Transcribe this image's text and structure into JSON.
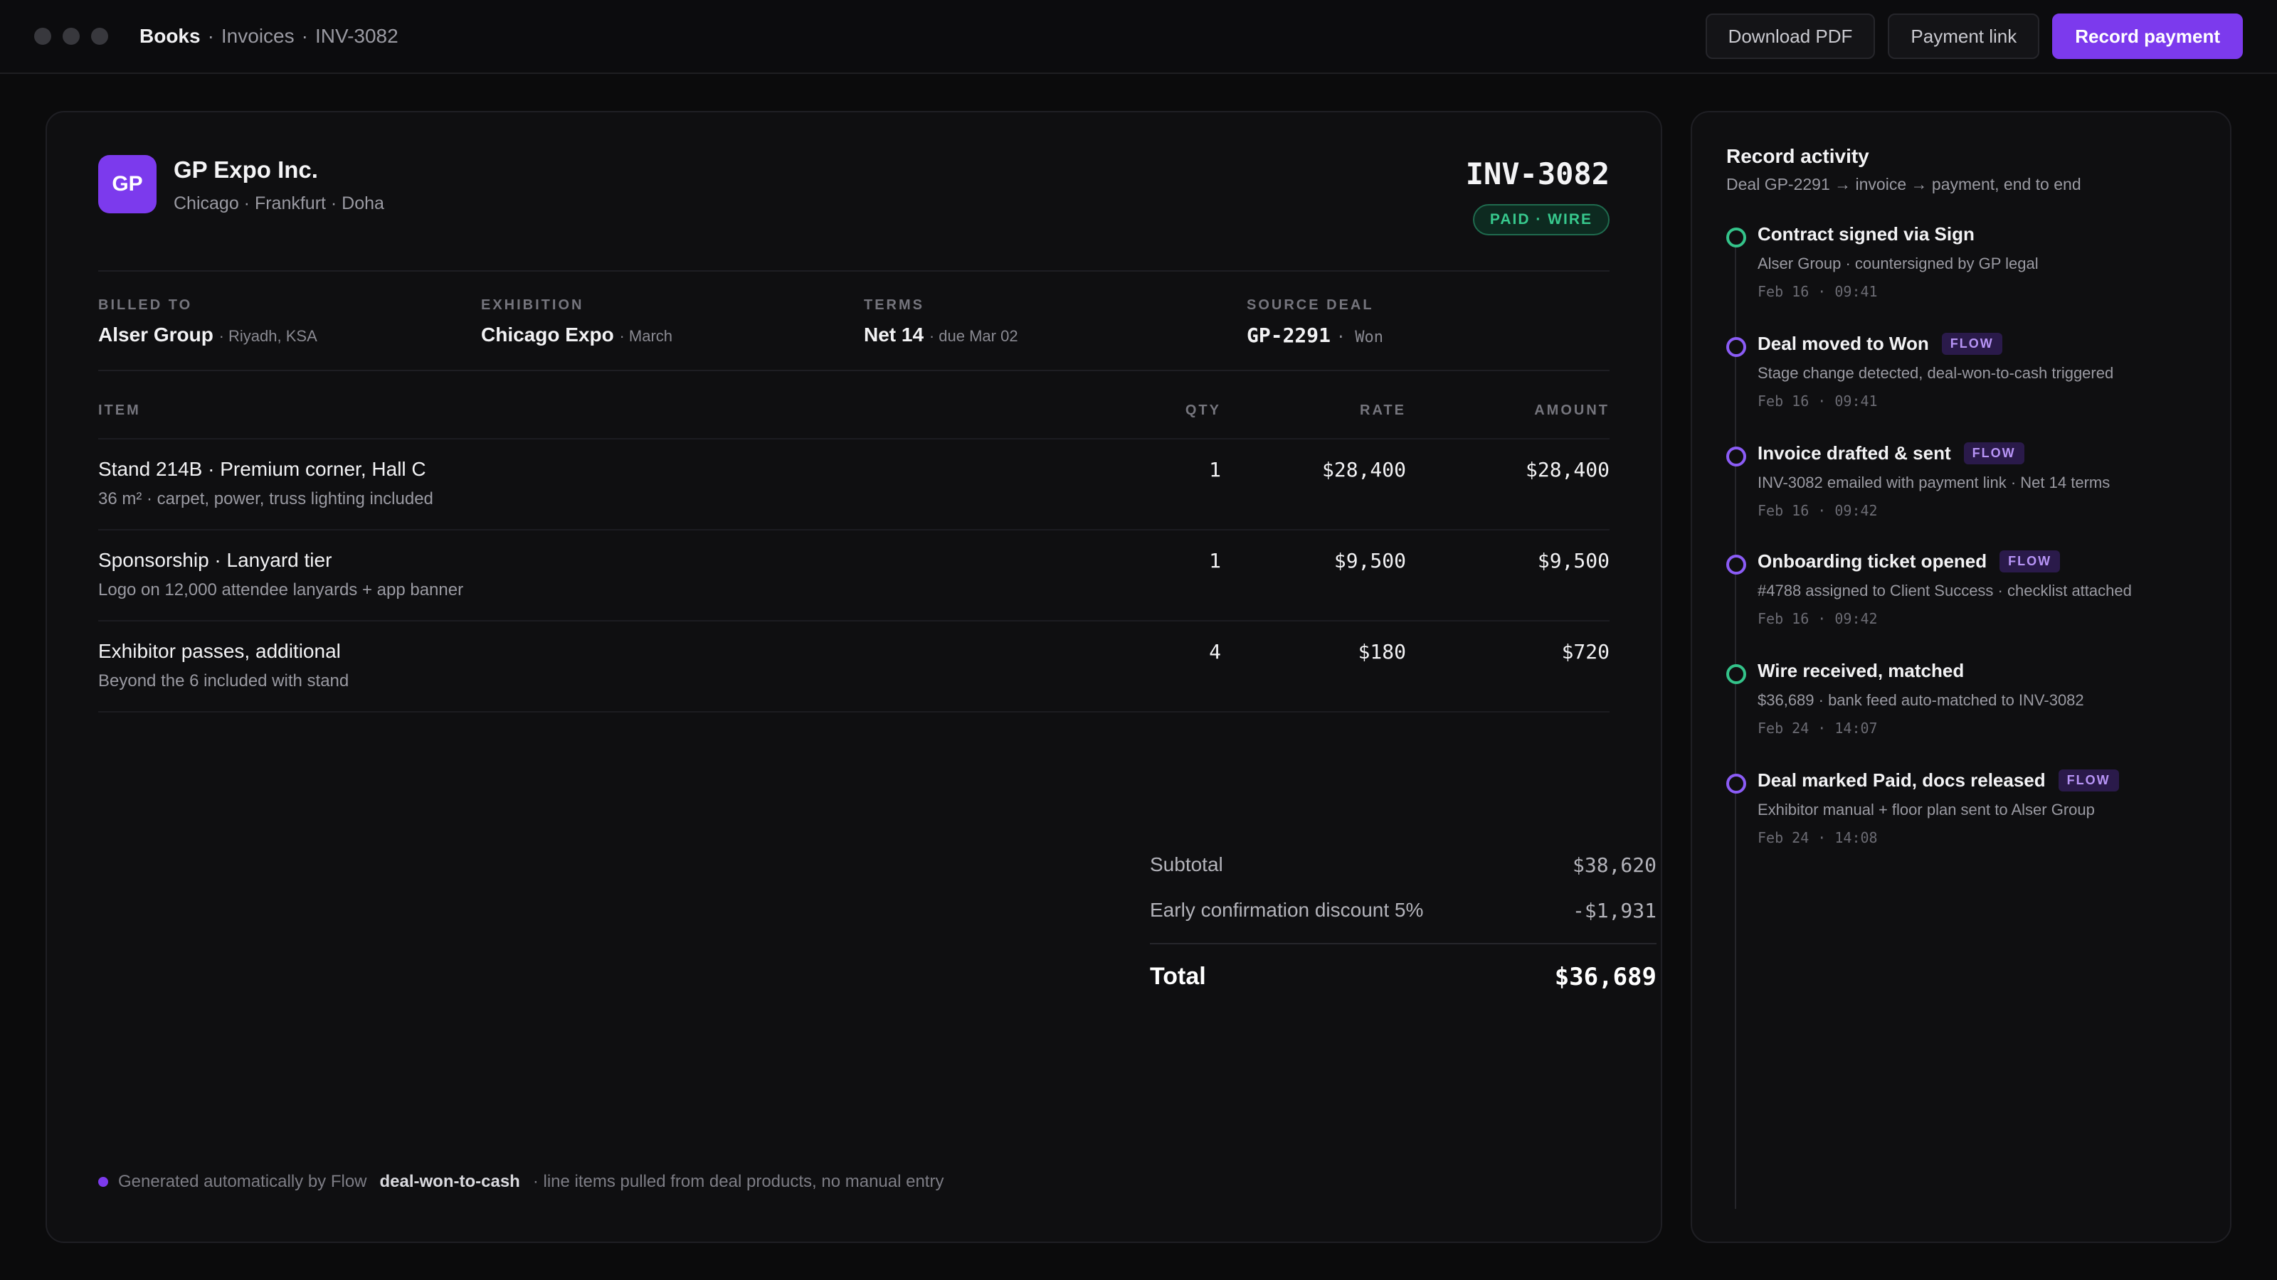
{
  "topbar": {
    "breadcrumb": {
      "root": "Books",
      "section": "Invoices",
      "current": "INV-3082",
      "separator": "·"
    },
    "actions": {
      "download": "Download PDF",
      "payment_link": "Payment link",
      "record": "Record payment"
    }
  },
  "invoice": {
    "company": {
      "initials": "GP",
      "name": "GP Expo Inc.",
      "cities": "Chicago · Frankfurt · Doha"
    },
    "number": "INV-3082",
    "status": "PAID · WIRE",
    "meta": {
      "billed_to": {
        "label": "BILLED TO",
        "value": "Alser Group",
        "sub": "· Riyadh, KSA"
      },
      "exhibition": {
        "label": "EXHIBITION",
        "value": "Chicago Expo",
        "sub": "· March"
      },
      "terms": {
        "label": "TERMS",
        "value": "Net 14",
        "sub": "· due Mar 02"
      },
      "source_deal": {
        "label": "SOURCE DEAL",
        "value": "GP-2291",
        "sub": "· Won"
      }
    },
    "columns": {
      "item": "ITEM",
      "qty": "QTY",
      "rate": "RATE",
      "amount": "AMOUNT"
    },
    "items": [
      {
        "title": "Stand 214B · Premium corner, Hall C",
        "desc": "36 m² · carpet, power, truss lighting included",
        "qty": "1",
        "rate": "$28,400",
        "amount": "$28,400"
      },
      {
        "title": "Sponsorship · Lanyard tier",
        "desc": "Logo on 12,000 attendee lanyards + app banner",
        "qty": "1",
        "rate": "$9,500",
        "amount": "$9,500"
      },
      {
        "title": "Exhibitor passes, additional",
        "desc": "Beyond the 6 included with stand",
        "qty": "4",
        "rate": "$180",
        "amount": "$720"
      }
    ],
    "totals": {
      "subtotal_label": "Subtotal",
      "subtotal": "$38,620",
      "discount_label": "Early confirmation discount 5%",
      "discount": "-$1,931",
      "total_label": "Total",
      "total": "$36,689"
    },
    "footer": {
      "prefix": "Generated automatically by Flow",
      "flow": "deal-won-to-cash",
      "suffix": "· line items pulled from deal products, no manual entry"
    }
  },
  "activity": {
    "title": "Record activity",
    "subtitle": "Deal GP-2291 → invoice → payment, end to end",
    "events": [
      {
        "title": "Contract signed via Sign",
        "tag": "",
        "desc": "Alser Group · countersigned by GP legal",
        "time": "Feb 16 · 09:41",
        "color": "#34c38a"
      },
      {
        "title": "Deal moved to Won",
        "tag": "FLOW",
        "desc": "Stage change detected, deal-won-to-cash triggered",
        "time": "Feb 16 · 09:41",
        "color": "#8b5cf6"
      },
      {
        "title": "Invoice drafted & sent",
        "tag": "FLOW",
        "desc": "INV-3082 emailed with payment link · Net 14 terms",
        "time": "Feb 16 · 09:42",
        "color": "#8b5cf6"
      },
      {
        "title": "Onboarding ticket opened",
        "tag": "FLOW",
        "desc": "#4788 assigned to Client Success · checklist attached",
        "time": "Feb 16 · 09:42",
        "color": "#8b5cf6"
      },
      {
        "title": "Wire received, matched",
        "tag": "",
        "desc": "$36,689 · bank feed auto-matched to INV-3082",
        "time": "Feb 24 · 14:07",
        "color": "#34c38a"
      },
      {
        "title": "Deal marked Paid, docs released",
        "tag": "FLOW",
        "desc": "Exhibitor manual + floor plan sent to Alser Group",
        "time": "Feb 24 · 14:08",
        "color": "#8b5cf6"
      }
    ]
  },
  "colors": {
    "accent": "#7c3aed",
    "success": "#34c38a",
    "flow": "#8b5cf6"
  }
}
